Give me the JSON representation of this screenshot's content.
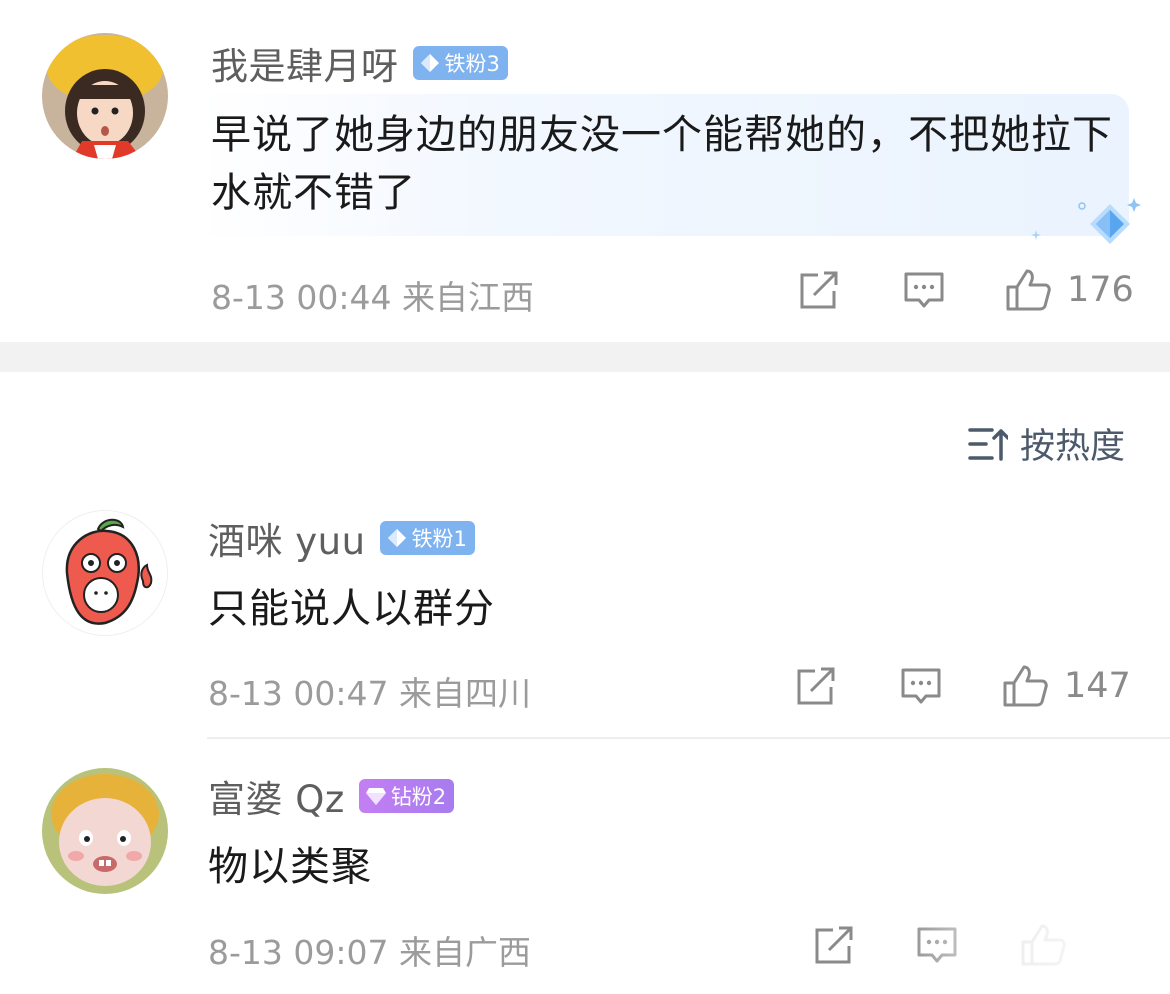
{
  "colors": {
    "iron_badge": "#7fb3f0",
    "diamond_badge": "#b07cf0",
    "meta_gray": "#9b9b9b",
    "highlight_bubble": "#eef4fd",
    "divider": "#f2f2f2"
  },
  "top_comment": {
    "username": "我是肆月呀",
    "badge": {
      "label": "铁粉3",
      "icon": "diamond-icon"
    },
    "text": "早说了她身边的朋友没一个能帮她的，不把她拉下水就不错了",
    "meta": "8-13 00:44 来自江西",
    "like_count": "176"
  },
  "sort": {
    "label": "按热度",
    "icon": "sort-icon"
  },
  "comments": [
    {
      "username": "酒咪 yuu",
      "badge": {
        "label": "铁粉1",
        "icon": "diamond-icon"
      },
      "text": "只能说人以群分",
      "meta": "8-13 00:47 来自四川",
      "like_count": "147"
    },
    {
      "username": "富婆 Qz",
      "badge": {
        "label": "钻粉2",
        "icon": "diamond-icon"
      },
      "text": "物以类聚",
      "meta": "8-13 09:07 来自广西",
      "like_count": ""
    }
  ]
}
